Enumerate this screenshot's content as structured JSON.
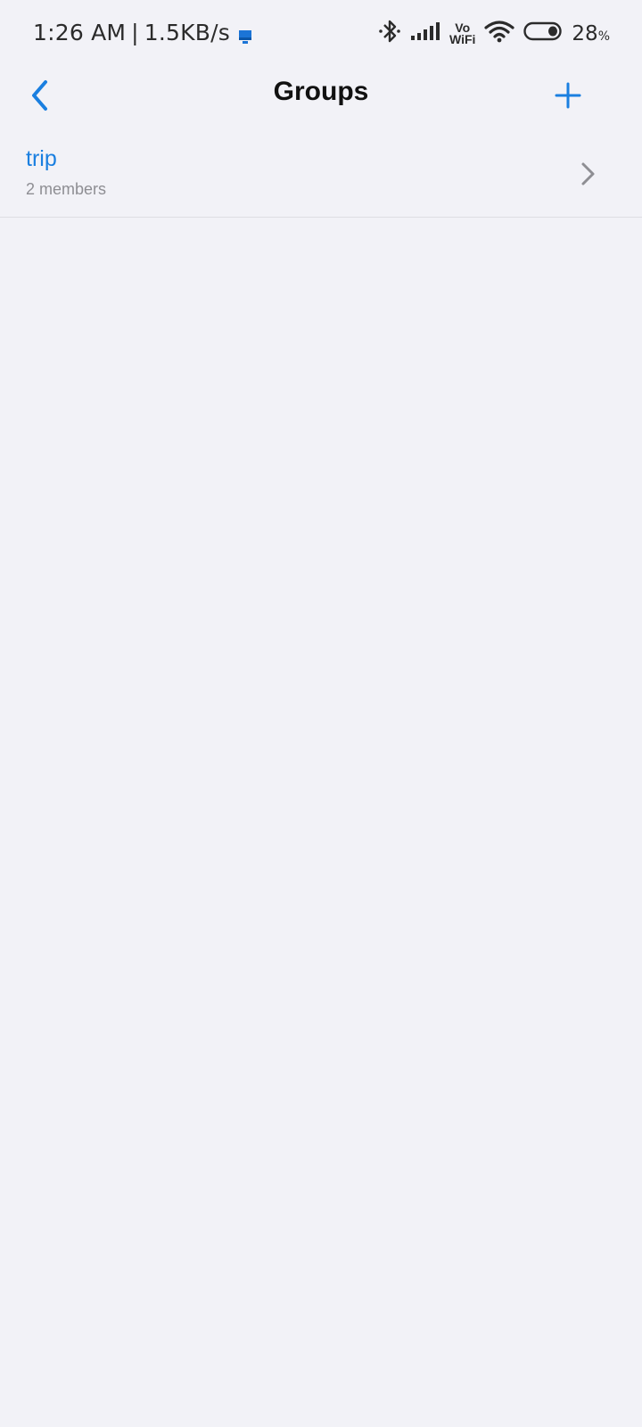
{
  "status_bar": {
    "time": "1:26 AM",
    "separator": "|",
    "net_speed": "1.5KB/s",
    "vo_label": "Vo",
    "wifi_label": "WiFi",
    "battery_level": "28",
    "battery_unit": "%",
    "icons": [
      "data-saver-icon",
      "bluetooth-icon",
      "signal-icon",
      "wifi-icon",
      "battery-icon"
    ]
  },
  "nav": {
    "title": "Groups",
    "back_icon": "chevron-left-icon",
    "add_icon": "plus-icon"
  },
  "groups": [
    {
      "name": "trip",
      "members": "2 members"
    }
  ],
  "colors": {
    "accent": "#1a7fe0",
    "background": "#f2f2f7",
    "secondary_text": "#8e8e93"
  }
}
